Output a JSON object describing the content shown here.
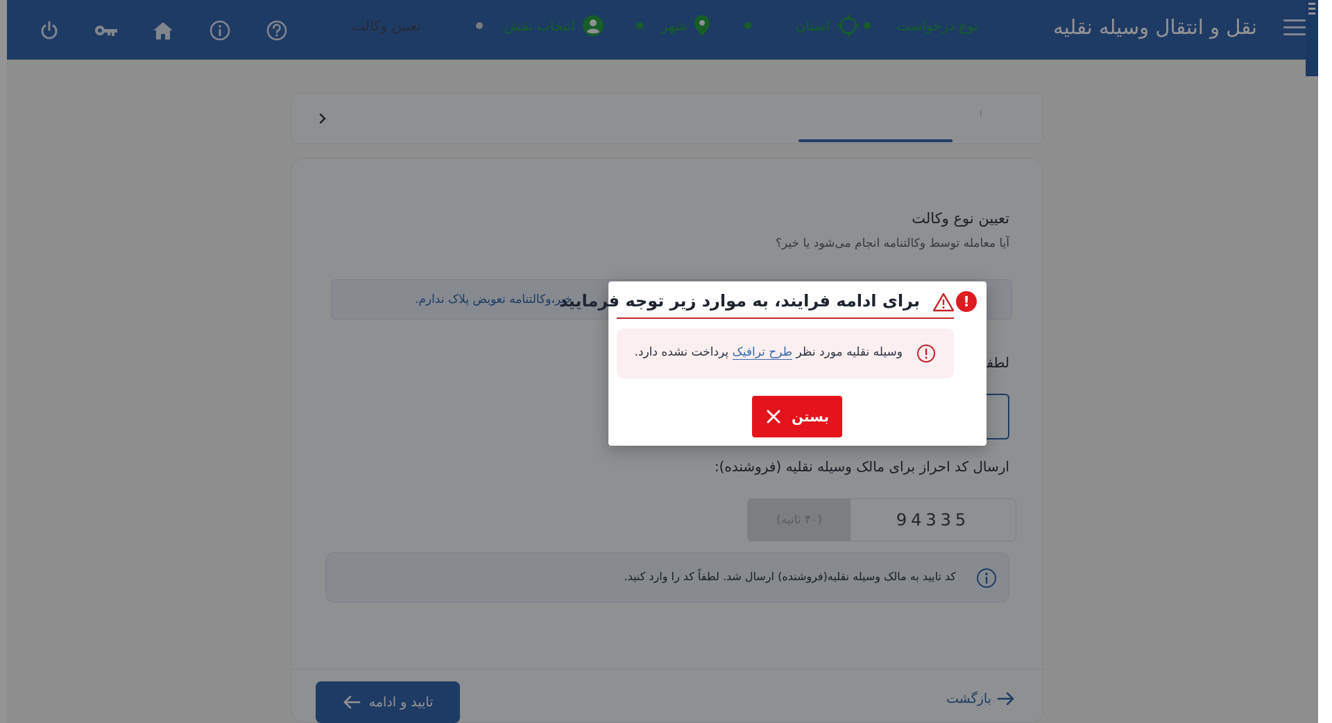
{
  "header": {
    "title": "نقل و انتقال وسیله نقلیه",
    "icons": [
      "power-icon",
      "key-icon",
      "home-icon",
      "info-icon",
      "help-icon"
    ],
    "bg_color": "#3466ad"
  },
  "steps": {
    "items": [
      {
        "label": "نوع درخواست",
        "status": "done"
      },
      {
        "label": "استان",
        "status": "active"
      },
      {
        "label": "شهر",
        "status": "done"
      },
      {
        "label": "انتخاب نقش",
        "status": "done"
      },
      {
        "label": "تعیین وکالت",
        "status": "pending"
      }
    ]
  },
  "form": {
    "section_title": "تعیین نوع وکالت",
    "section_subtitle": "آیا معامله توسط وکالتنامه انجام می‌شود یا خیر؟",
    "option_text": "خیر،وکالتنامه تعویض پلاک ندارم.",
    "partial_label": "لطفا",
    "send_label": "ارسال کد احراز برای مالک وسیله نقلیه (فروشنده):",
    "code_value": "94335",
    "timer_text": "(۴۰ ثانیه)",
    "info_text": "کد تایید به مالک وسیله نقلیه(فروشنده) ارسال شد. لطفاً کد را وارد کنید."
  },
  "footer": {
    "continue_label": "تایید و ادامه",
    "back_label": "بازگشت"
  },
  "modal": {
    "title": "برای ادامه فرایند، به موارد زیر توجه فرمایید",
    "alert_before": "وسیله نقلیه مورد نظر",
    "alert_link": "طرح ترافیک",
    "alert_after": "پرداخت نشده دارد.",
    "close_label": "بستن",
    "error_color": "#e3141c"
  }
}
